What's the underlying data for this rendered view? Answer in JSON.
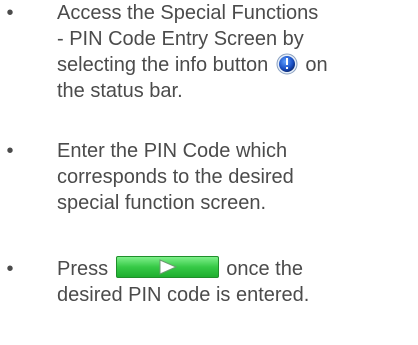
{
  "bullet_char": "•",
  "items": [
    {
      "lines": [
        "Access the Special Functions",
        "- PIN Code Entry Screen by",
        "selecting the info button",
        "on",
        "the status bar."
      ],
      "icon": "info-button-icon"
    },
    {
      "lines": [
        "Enter the PIN Code which",
        "corresponds to the desired",
        "special function screen."
      ]
    },
    {
      "lines": [
        "Press",
        "once the",
        "desired PIN code is entered."
      ],
      "icon": "green-play-button"
    }
  ],
  "colors": {
    "text": "#4b4b4b",
    "play_button_green": "#36c946",
    "info_icon_blue": "#1a4fc4"
  }
}
